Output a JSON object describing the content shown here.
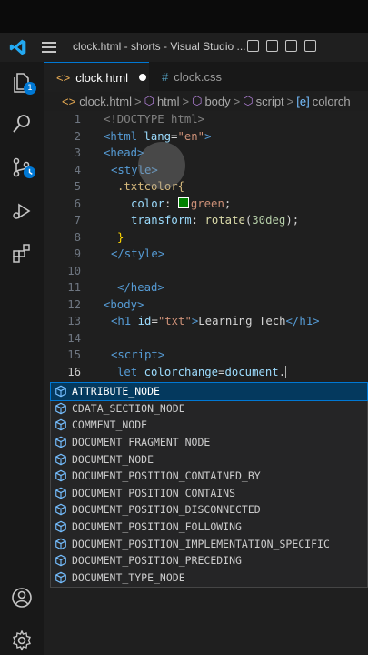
{
  "window": {
    "title": "clock.html - shorts - Visual Studio ..."
  },
  "tabs": [
    {
      "label": "clock.html",
      "icon": "html-file-icon",
      "modified": true
    },
    {
      "label": "clock.css",
      "icon": "css-file-icon",
      "modified": false
    }
  ],
  "breadcrumb": [
    "clock.html",
    "html",
    "body",
    "script",
    "colorch"
  ],
  "activity_bar": {
    "explorer_badge": "1"
  },
  "editor": {
    "line_numbers": [
      "1",
      "2",
      "3",
      "4",
      "5",
      "6",
      "7",
      "8",
      "9",
      "10",
      "11",
      "12",
      "13",
      "14",
      "15",
      "16"
    ],
    "lines": {
      "l1": "<!DOCTYPE html>",
      "l2a": "<html ",
      "l2b": "lang",
      "l2c": "=",
      "l2d": "\"en\"",
      "l2e": ">",
      "l3": "<head>",
      "l4": "<style>",
      "l5": ".txtcolor{",
      "l6a": "color",
      "l6b": ": ",
      "l6c": "green",
      "l6d": ";",
      "l7a": "transform",
      "l7b": ": ",
      "l7c": "rotate",
      "l7d": "(",
      "l7e": "30deg",
      "l7f": ");",
      "l8": "}",
      "l9": "</style>",
      "l10": "",
      "l11": "</head>",
      "l12": "<body>",
      "l13a": "<h1 ",
      "l13b": "id",
      "l13c": "=",
      "l13d": "\"txt\"",
      "l13e": ">",
      "l13f": "Learning Tech",
      "l13g": "</h1>",
      "l14": "",
      "l15": "<script>",
      "l16a": "let ",
      "l16b": "colorchange",
      "l16c": "=",
      "l16d": "document",
      "l16e": "."
    }
  },
  "autocomplete": {
    "items": [
      "ATTRIBUTE_NODE",
      "CDATA_SECTION_NODE",
      "COMMENT_NODE",
      "DOCUMENT_FRAGMENT_NODE",
      "DOCUMENT_NODE",
      "DOCUMENT_POSITION_CONTAINED_BY",
      "DOCUMENT_POSITION_CONTAINS",
      "DOCUMENT_POSITION_DISCONNECTED",
      "DOCUMENT_POSITION_FOLLOWING",
      "DOCUMENT_POSITION_IMPLEMENTATION_SPECIFIC",
      "DOCUMENT_POSITION_PRECEDING",
      "DOCUMENT_TYPE_NODE"
    ],
    "selected_index": 0
  },
  "colors": {
    "accent": "#0078d4",
    "editor_bg": "#1f1f1f",
    "activity_bg": "#181818"
  }
}
